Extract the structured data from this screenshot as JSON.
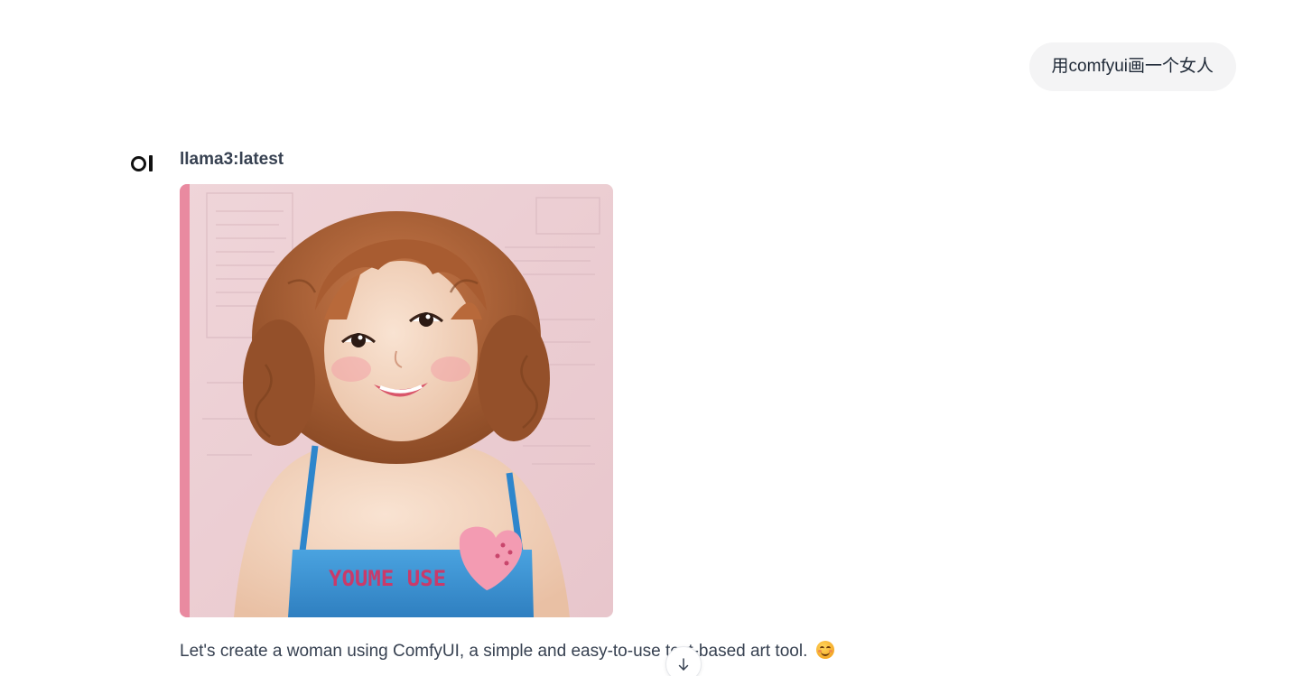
{
  "user_message": {
    "text": "用comfyui画一个女人"
  },
  "assistant": {
    "logo_icon": "open-webui-logo-icon",
    "model_name": "llama3:latest",
    "image": {
      "subject": "generated-woman-portrait",
      "shirt_text": "YOUME USE"
    },
    "reply": "Let's create a woman using ComfyUI, a simple and easy-to-use text-based art tool.",
    "reply_emoji": "smiling-face-icon"
  },
  "scroll_button": {
    "icon": "arrow-down-icon"
  },
  "colors": {
    "user_bubble_bg": "#f4f4f5",
    "text": "#374151",
    "image_wall": "#f1d3d8",
    "image_shirt": "#3b8fd1",
    "image_hair": "#a0582e"
  }
}
